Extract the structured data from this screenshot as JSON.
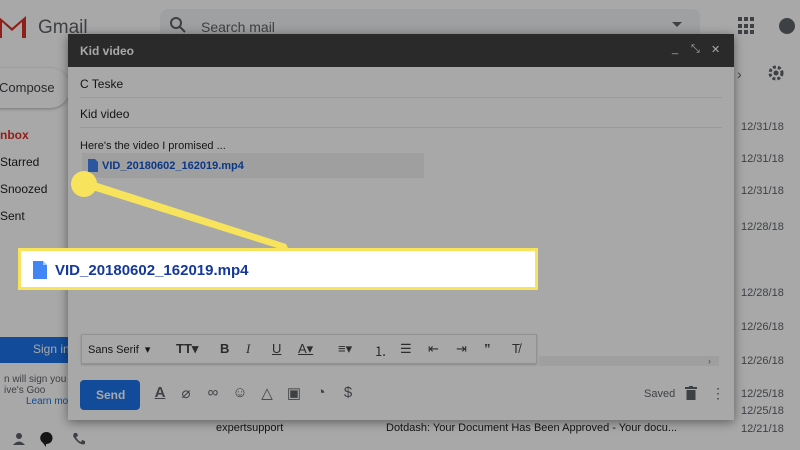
{
  "gmail": {
    "logo_text": "Gmail",
    "search_placeholder": "Search mail",
    "compose_label": "Compose",
    "nav": [
      "nbox",
      "Starred",
      "Snoozed",
      "Sent"
    ],
    "signin_label": "Sign in",
    "signin_note_1": "n will sign you",
    "signin_note_2": "ive's Goo",
    "signin_note_link": "Learn mo",
    "dates": [
      "12/31/18",
      "12/31/18",
      "12/31/18",
      "12/28/18",
      "12/28/18",
      "12/26/18",
      "12/26/18",
      "12/25/18",
      "12/25/18",
      "12/21/18"
    ],
    "bottom_row": {
      "sender": "expertsupport",
      "subject": "Dotdash: Your Document Has Been Approved - Your docu..."
    }
  },
  "compose": {
    "title": "Kid video",
    "to": "C Teske",
    "subject": "Kid video",
    "body": "Here's the video I promised ...",
    "attachment": "VID_20180602_162019.mp4",
    "toolbar": {
      "font": "Sans Serif",
      "icons": [
        "text-size-icon",
        "bold-icon",
        "italic-icon",
        "underline-icon",
        "text-color-icon",
        "align-icon",
        "numbered-list-icon",
        "bulleted-list-icon",
        "indent-less-icon",
        "indent-more-icon",
        "quote-icon",
        "remove-formatting-icon"
      ]
    },
    "send_label": "Send",
    "saved_label": "Saved"
  },
  "callout": {
    "attachment": "VID_20180602_162019.mp4",
    "color": "#f8e45c"
  }
}
